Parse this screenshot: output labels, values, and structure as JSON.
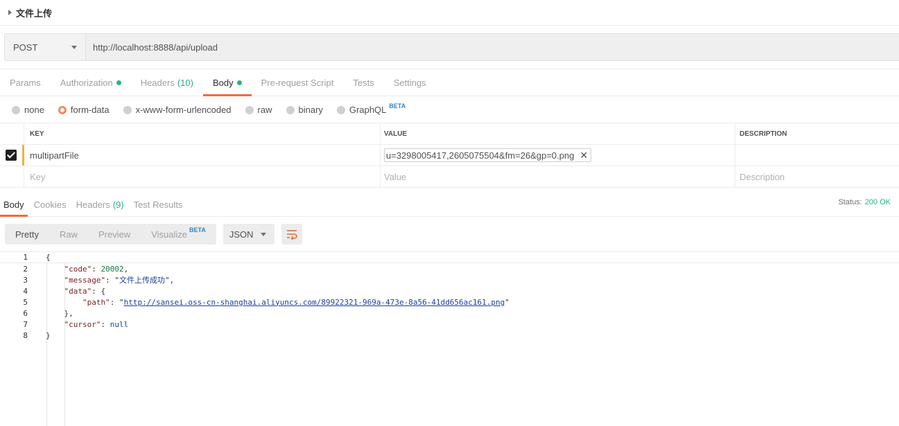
{
  "request": {
    "name": "文件上传",
    "method": "POST",
    "url": "http://localhost:8888/api/upload"
  },
  "request_tabs": [
    {
      "label": "Params",
      "count": "",
      "dot": false,
      "active": false
    },
    {
      "label": "Authorization",
      "count": "",
      "dot": true,
      "active": false
    },
    {
      "label": "Headers",
      "count": "(10)",
      "dot": false,
      "active": false
    },
    {
      "label": "Body",
      "count": "",
      "dot": true,
      "active": true
    },
    {
      "label": "Pre-request Script",
      "count": "",
      "dot": false,
      "active": false
    },
    {
      "label": "Tests",
      "count": "",
      "dot": false,
      "active": false
    },
    {
      "label": "Settings",
      "count": "",
      "dot": false,
      "active": false
    }
  ],
  "body_types": [
    {
      "label": "none",
      "selected": false,
      "beta": ""
    },
    {
      "label": "form-data",
      "selected": true,
      "beta": ""
    },
    {
      "label": "x-www-form-urlencoded",
      "selected": false,
      "beta": ""
    },
    {
      "label": "raw",
      "selected": false,
      "beta": ""
    },
    {
      "label": "binary",
      "selected": false,
      "beta": ""
    },
    {
      "label": "GraphQL",
      "selected": false,
      "beta": "BETA"
    }
  ],
  "form_table": {
    "headers": {
      "key": "KEY",
      "value": "VALUE",
      "description": "DESCRIPTION"
    },
    "row": {
      "key": "multipartFile",
      "file": "u=3298005417,2605075504&fm=26&gp=0.png",
      "remove": "✕"
    },
    "placeholders": {
      "key": "Key",
      "value": "Value",
      "description": "Description"
    }
  },
  "response": {
    "tabs": [
      {
        "label": "Body",
        "count": "",
        "active": true
      },
      {
        "label": "Cookies",
        "count": "",
        "active": false
      },
      {
        "label": "Headers",
        "count": "(9)",
        "active": false
      },
      {
        "label": "Test Results",
        "count": "",
        "active": false
      }
    ],
    "status_label": "Status:",
    "status_value": "200 OK",
    "views": [
      {
        "label": "Pretty",
        "active": true,
        "beta": ""
      },
      {
        "label": "Raw",
        "active": false,
        "beta": ""
      },
      {
        "label": "Preview",
        "active": false,
        "beta": ""
      },
      {
        "label": "Visualize",
        "active": false,
        "beta": "BETA"
      }
    ],
    "format": "JSON",
    "code_lines": [
      {
        "no": "1",
        "text": "{"
      },
      {
        "no": "2",
        "text": "    \"code\": 20002,"
      },
      {
        "no": "3",
        "text": "    \"message\": \"文件上传成功\","
      },
      {
        "no": "4",
        "text": "    \"data\": {"
      },
      {
        "no": "5",
        "text": "        \"path\": \"http://sansei.oss-cn-shanghai.aliyuncs.com/89922321-969a-473e-8a56-41dd656ac161.png\""
      },
      {
        "no": "6",
        "text": "    },"
      },
      {
        "no": "7",
        "text": "    \"cursor\": null"
      },
      {
        "no": "8",
        "text": "}"
      }
    ]
  },
  "colors": {
    "accent": "#f26b3a",
    "success": "#26b47f",
    "beta": "#2e86c8"
  }
}
